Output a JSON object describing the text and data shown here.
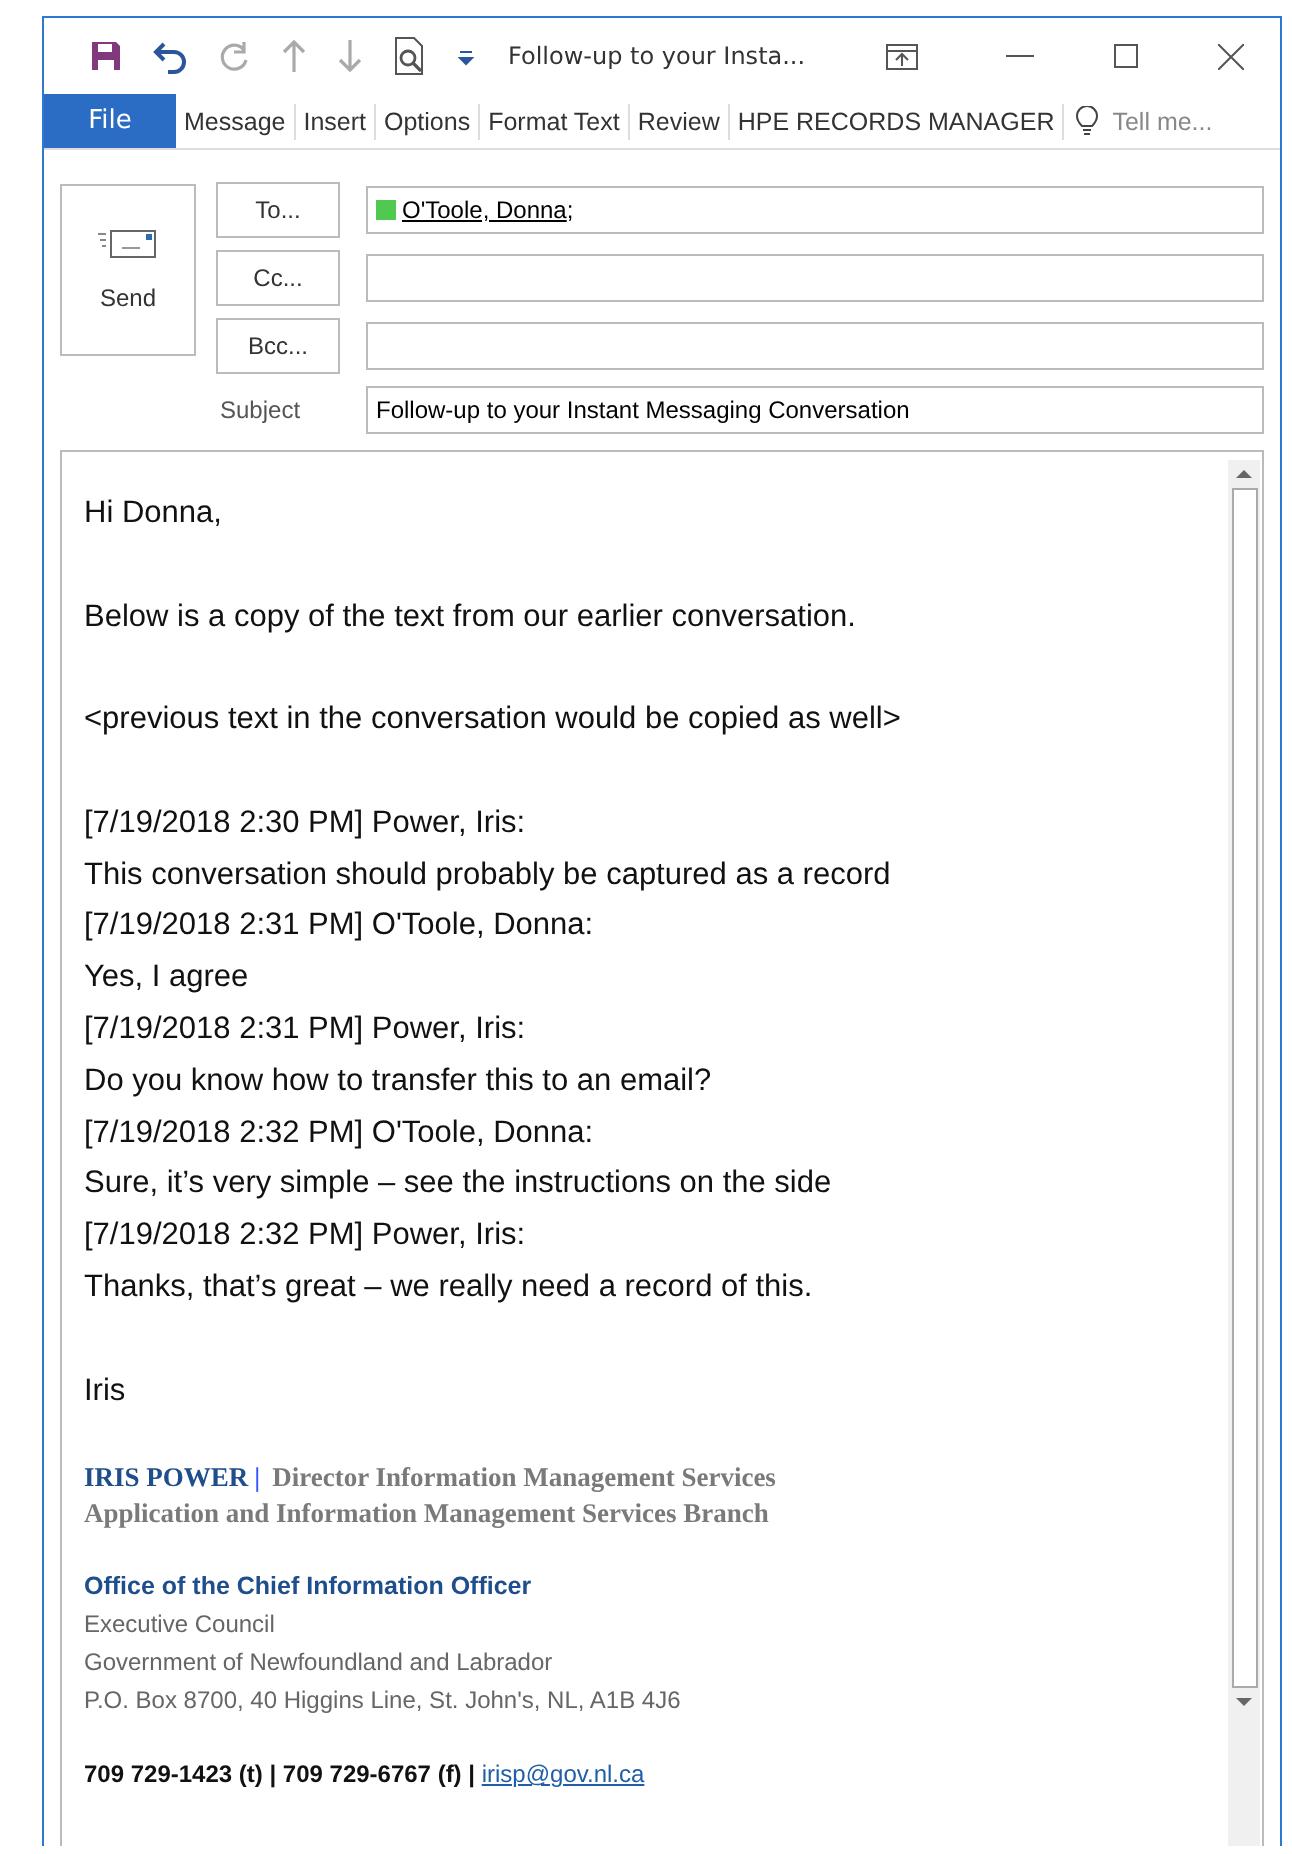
{
  "window": {
    "title": "Follow-up to your Insta..."
  },
  "ribbon": {
    "file_button": "File",
    "tabs": [
      "Message",
      "Insert",
      "Options",
      "Format Text",
      "Review",
      "HPE RECORDS MANAGER"
    ],
    "tell_me": {
      "placeholder": "Tell me..."
    }
  },
  "send_button": "Send",
  "address_fields": [
    {
      "label": "To...",
      "recipients": [
        {
          "name": "O'Toole, Donna",
          "separator": ";",
          "color": "#4fc94f"
        }
      ]
    },
    {
      "label": "Cc..."
    },
    {
      "label": "Bcc..."
    }
  ],
  "subject": {
    "label": "Subject",
    "value": "Follow-up to your Instant Messaging Conversation"
  },
  "body": {
    "paragraphs": [
      [
        "Hi Donna,"
      ],
      [
        "Below is a copy of the text from our earlier conversation."
      ],
      [
        "<previous text in the conversation would be copied as well>"
      ],
      [
        "[7/19/2018 2:30 PM] Power, Iris:",
        "This conversation should probably be captured as a record",
        "[7/19/2018 2:31 PM] O'Toole, Donna:",
        "Yes, I agree",
        "[7/19/2018 2:31 PM] Power, Iris:",
        "Do you know how to transfer this to an email?",
        "[7/19/2018 2:32 PM] O'Toole, Donna:",
        "Sure, it’s very simple – see the instructions on the side",
        "[7/19/2018 2:32 PM] Power, Iris:",
        "Thanks, that’s great – we really need a record of this."
      ],
      [
        "Iris"
      ]
    ]
  },
  "signature": {
    "name": "IRIS POWER",
    "divider": "|",
    "position": "Director Information Management Services",
    "branch": "Application and Information Management Services Branch",
    "office": "Office of the Chief Information Officer",
    "address_lines": [
      "Executive Council",
      "Government of Newfoundland and Labrador",
      "P.O. Box 8700, 40 Higgins Line, St. John's, NL, A1B 4J6"
    ],
    "contact": "709 729-1423 (t) | 709 729-6767 (f) | ",
    "email": "irisp@gov.nl.ca"
  }
}
